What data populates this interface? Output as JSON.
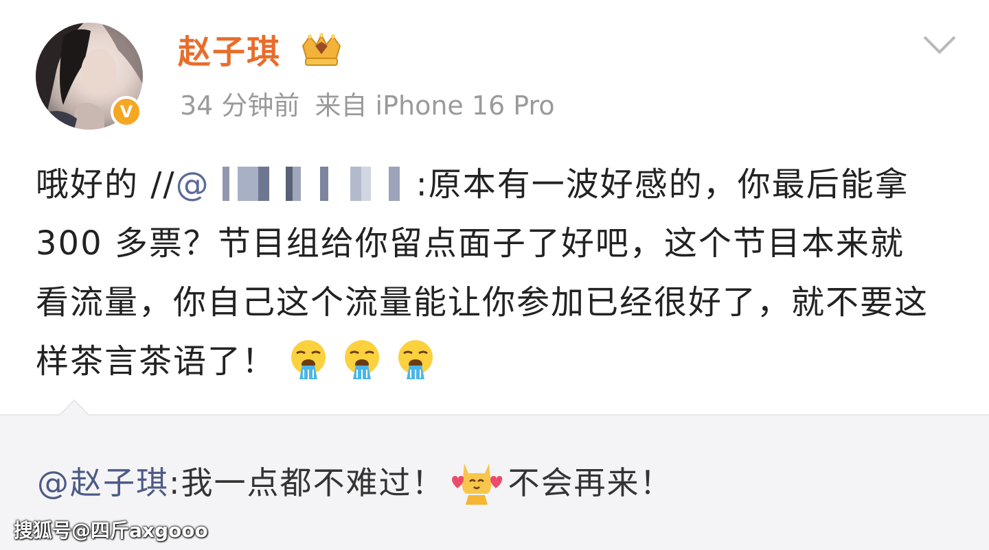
{
  "post": {
    "username": "赵子琪",
    "time": "34 分钟前",
    "source": "来自 iPhone 16 Pro",
    "content_prefix": "哦好的 //",
    "mention_at": "@",
    "content_after_mention": ":原本有一波好感的，你最后能拿 300 多票？节目组给你留点面子了好吧，这个节目本来就看流量，你自己这个流量能让你参加已经很好了，就不要这样茶言茶语了！",
    "emojis": [
      "puke-emoji",
      "puke-emoji",
      "puke-emoji"
    ]
  },
  "reply": {
    "mention": "@赵子琪",
    "text_before_sticker": ":我一点都不难过！",
    "text_after_sticker": "不会再来！"
  },
  "watermark": "搜狐号@四斤axgooo",
  "colors": {
    "username": "#e86d2b",
    "meta": "#9a9a9a",
    "mention": "#4c5a86",
    "reply_bg": "#f4f4f6",
    "badge": "#f5a623"
  }
}
